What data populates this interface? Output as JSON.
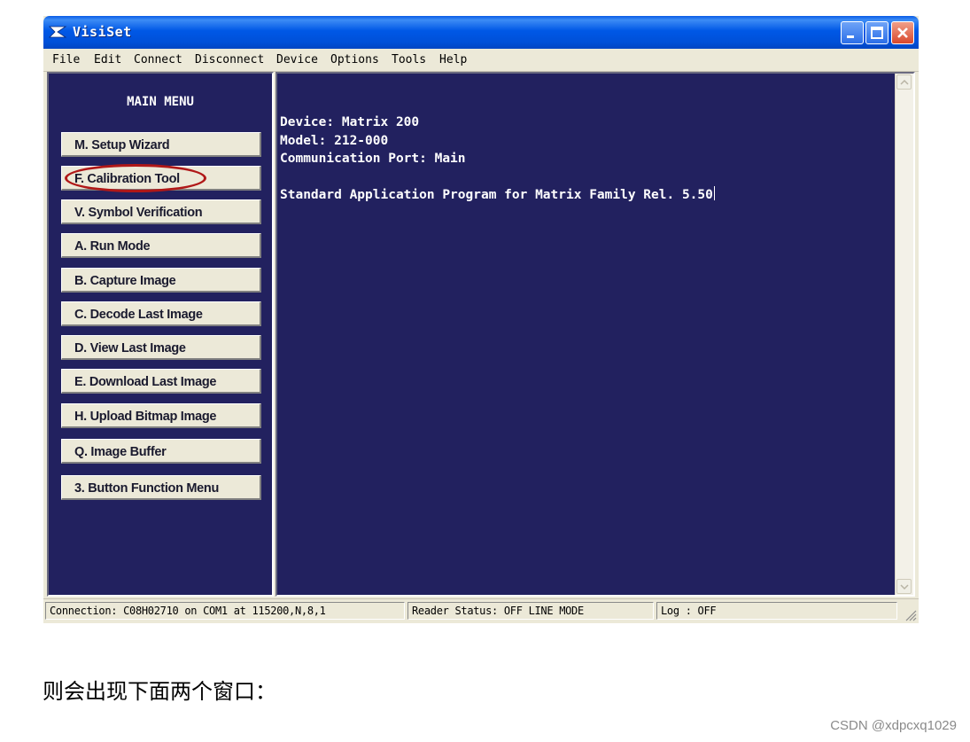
{
  "window": {
    "title": "VisiSet"
  },
  "menubar": {
    "items": [
      "File",
      "Edit",
      "Connect",
      "Disconnect",
      "Device",
      "Options",
      "Tools",
      "Help"
    ]
  },
  "main_menu": {
    "title": "MAIN MENU",
    "buttons": [
      "M. Setup Wizard",
      "F. Calibration Tool",
      "V. Symbol Verification",
      "A. Run Mode",
      "B. Capture Image",
      "C. Decode Last Image",
      "D. View Last Image",
      "E. Download Last Image",
      "H. Upload Bitmap Image",
      "Q. Image Buffer",
      "3. Button Function Menu"
    ],
    "highlighted": "F. Calibration Tool",
    "highlight_color": "#b01818"
  },
  "terminal": {
    "lines": [
      "Device: Matrix 200",
      "Model: 212-000",
      "Communication Port: Main",
      "",
      "Standard Application Program for Matrix Family Rel. 5.50"
    ],
    "background": "#22215f",
    "foreground": "#ffffff"
  },
  "statusbar": {
    "connection": "Connection: C08H02710 on COM1 at 115200,N,8,1",
    "reader_status": "Reader Status: OFF LINE MODE",
    "log": "Log : OFF"
  },
  "caption": "则会出现下面两个窗口：",
  "watermark": "CSDN @xdpcxq1029",
  "icons": {
    "app": "visiset-logo-icon",
    "minimize": "minimize-icon",
    "maximize": "maximize-icon",
    "close": "close-icon",
    "scroll_up": "scroll-up-arrow-icon",
    "scroll_down": "scroll-down-arrow-icon",
    "grip": "resize-grip-icon"
  }
}
